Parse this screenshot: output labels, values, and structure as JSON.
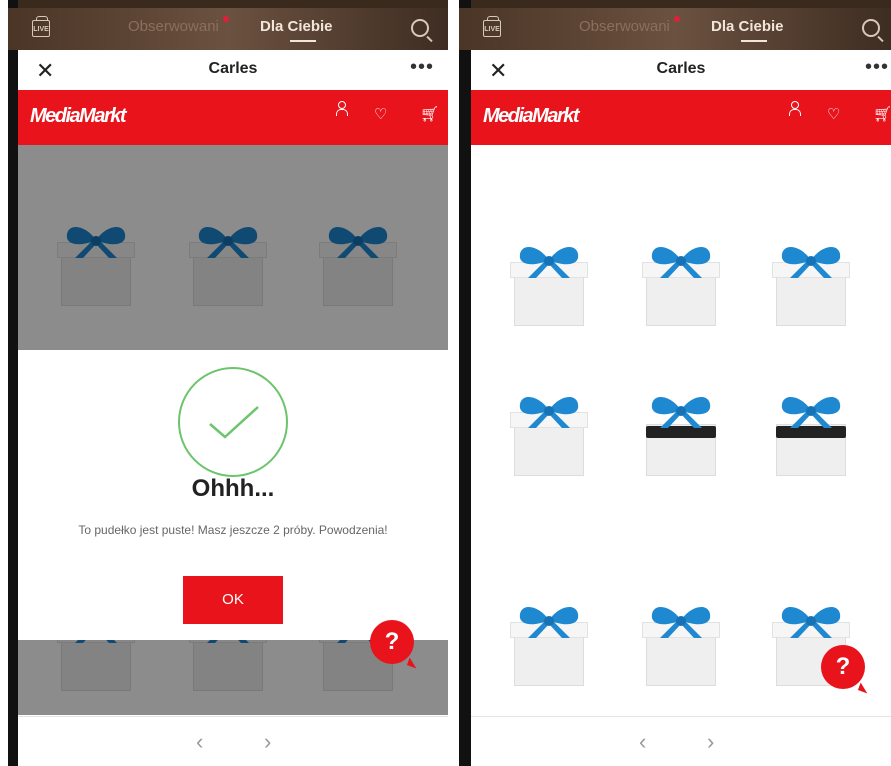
{
  "screens": [
    {
      "id": "left",
      "topbar": {
        "live_label": "LIVE",
        "tab_followed": "Obserwowani",
        "tab_for_you": "Dla Ciebie"
      },
      "header": {
        "title": "Carles"
      },
      "store": {
        "logo": "MediaMarkt"
      },
      "modal": {
        "title": "Ohhh...",
        "message": "To pudełko jest puste! Masz jeszcze 2 próby. Powodzenia!",
        "ok_label": "OK"
      },
      "help_label": "?"
    },
    {
      "id": "right",
      "topbar": {
        "live_label": "LIVE",
        "tab_followed": "Obserwowani",
        "tab_for_you": "Dla Ciebie"
      },
      "header": {
        "title": "Carles"
      },
      "store": {
        "logo": "MediaMarkt"
      },
      "boxes_open": [
        false,
        false,
        false,
        false,
        true,
        true,
        false,
        false,
        false
      ],
      "help_label": "?"
    }
  ],
  "colors": {
    "brand_red": "#e8131b",
    "bow_blue": "#1e88d0",
    "check_green": "#6cc46c"
  }
}
